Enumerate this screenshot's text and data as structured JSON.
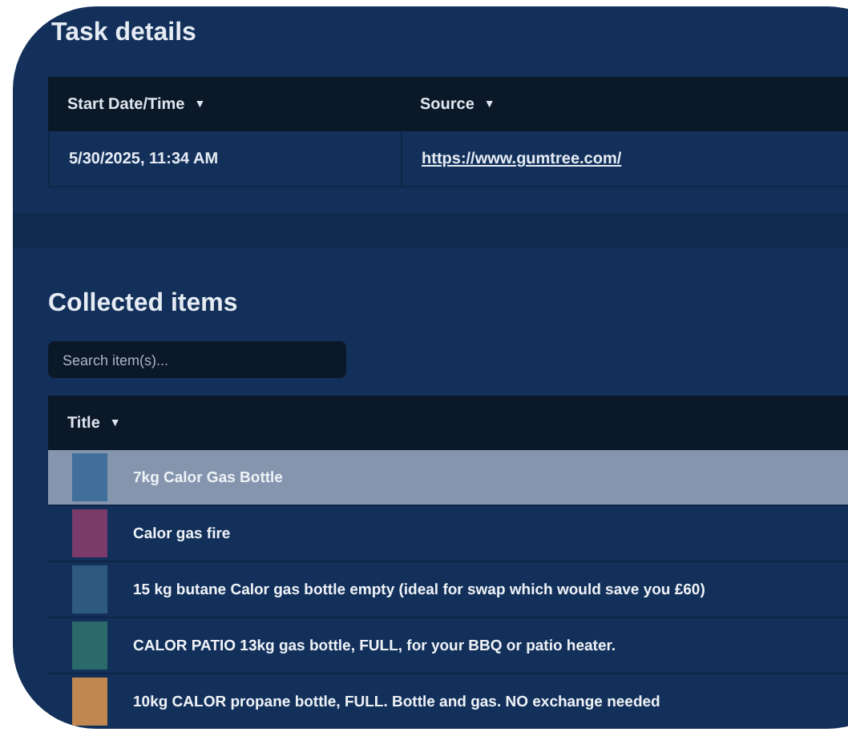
{
  "task_details": {
    "title": "Task details",
    "columns": [
      {
        "label": "Start Date/Time",
        "sort_icon": "▼"
      },
      {
        "label": "Source",
        "sort_icon": "▼"
      }
    ],
    "row": {
      "start": "5/30/2025, 11:34 AM",
      "source": "https://www.gumtree.com/"
    }
  },
  "collected_items": {
    "title": "Collected items",
    "search": {
      "placeholder": "Search item(s)..."
    },
    "column": {
      "label": "Title",
      "sort_icon": "▼"
    },
    "rows": [
      {
        "title": "7kg Calor Gas Bottle",
        "selected": true,
        "color": "#3f6f9a"
      },
      {
        "title": "Calor gas fire",
        "selected": false,
        "color": "#7a3a6a"
      },
      {
        "title": "15 kg butane Calor gas bottle empty (ideal for swap which would save you £60)",
        "selected": false,
        "color": "#2f5a80"
      },
      {
        "title": "CALOR PATIO 13kg gas bottle, FULL, for your BBQ or patio heater.",
        "selected": false,
        "color": "#2a6a6a"
      },
      {
        "title": "10kg CALOR propane bottle, FULL. Bottle and gas. NO exchange needed",
        "selected": false,
        "color": "#c08850"
      }
    ]
  }
}
